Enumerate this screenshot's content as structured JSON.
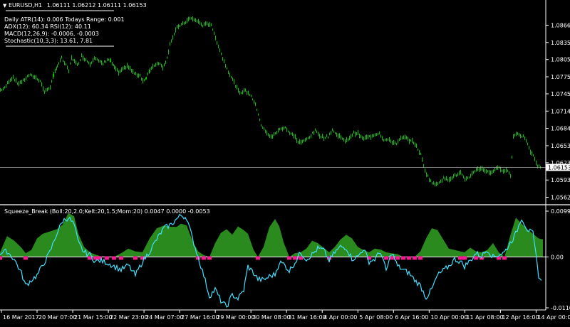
{
  "window": {
    "symbol_label": "EURUSD,H1",
    "ohlc": "1.06111 1.06212 1.06111 1.06153",
    "menu_icon": "triangle-down-icon"
  },
  "info_panel": {
    "atr": "Daily ATR(14): 0.006 Todays Range: 0.001",
    "adx_rsi": "ADX(12): 60.34 RSI(12): 40.11",
    "macd": "MACD(12,26,9): -0.0006, -0.0003",
    "stoch": "Stochastic(10,3,3): 13.61, 7.81"
  },
  "indicator": {
    "label": "Squeeze_Break (Boll:20,2.0;Kelt:20,1.5;Mom:20) 0.0047 0.0000 -0.0053"
  },
  "current_price": "1.06153",
  "colors": {
    "background": "#000000",
    "candle": "#00c800",
    "histogram": "#2a8a1e",
    "squeeze_dots": "#ff1493",
    "momentum_line": "#40e0ff",
    "price_line": "#b4b4b4",
    "axis_text": "#ffffff"
  },
  "chart_data": [
    {
      "type": "line",
      "name": "price",
      "yticks": [
        "1.08661",
        "1.08356",
        "1.08056",
        "1.07751",
        "1.07451",
        "1.07146",
        "1.06841",
        "1.06536",
        "1.06236",
        "1.05931",
        "1.05626"
      ],
      "xticks": [
        "16 Mar 2017",
        "20 Mar 07:00",
        "21 Mar 15:00",
        "22 Mar 23:00",
        "24 Mar 07:00",
        "27 Mar 16:00",
        "29 Mar 00:00",
        "30 Mar 08:00",
        "31 Mar 16:00",
        "4 Apr 00:00",
        "5 Apr 08:00",
        "6 Apr 16:00",
        "10 Apr 00:00",
        "11 Apr 08:00",
        "12 Apr 16:00",
        "14 Apr 00:00"
      ],
      "ylim": [
        1.0557,
        1.0898
      ],
      "current": 1.06153,
      "x": [
        0,
        6,
        12,
        18,
        24,
        32,
        40,
        48,
        56,
        62,
        70,
        75,
        80,
        86,
        92,
        96,
        100,
        104,
        108,
        114,
        120,
        126,
        132,
        138,
        144,
        150,
        155,
        160,
        166,
        172,
        178,
        184,
        190,
        196,
        200,
        205,
        210,
        216,
        222,
        228,
        234,
        238,
        244,
        248,
        252,
        256,
        260,
        266,
        272,
        278,
        284,
        290,
        296,
        300,
        306,
        312,
        318,
        324,
        330,
        336,
        342,
        346,
        352,
        358,
        362,
        366,
        370,
        376,
        382,
        388,
        394,
        400,
        406,
        412,
        418,
        424,
        430,
        436,
        442,
        448,
        454,
        460,
        466,
        472,
        478,
        484,
        490,
        496,
        502,
        508,
        514,
        520,
        526,
        532,
        538,
        544,
        550,
        556,
        562,
        568,
        574,
        580,
        586,
        590,
        594,
        598,
        602,
        606,
        610,
        616,
        622,
        628,
        634,
        640,
        646,
        652,
        658,
        664,
        670,
        676,
        682,
        688,
        694,
        700,
        706,
        712,
        716,
        720,
        726,
        730,
        736,
        742,
        748,
        754,
        760
      ],
      "values": [
        1.0752,
        1.0755,
        1.0768,
        1.0775,
        1.0763,
        1.0768,
        1.0778,
        1.0775,
        1.0768,
        1.0748,
        1.0758,
        1.0778,
        1.0795,
        1.0808,
        1.0795,
        1.0785,
        1.081,
        1.0802,
        1.0795,
        1.0812,
        1.0805,
        1.0798,
        1.081,
        1.0802,
        1.0798,
        1.0806,
        1.0803,
        1.0792,
        1.0782,
        1.0788,
        1.0795,
        1.0786,
        1.0779,
        1.0778,
        1.0768,
        1.0772,
        1.0788,
        1.0796,
        1.08,
        1.0792,
        1.0808,
        1.0834,
        1.085,
        1.0862,
        1.0866,
        1.0868,
        1.0872,
        1.0878,
        1.0876,
        1.0872,
        1.0866,
        1.0868,
        1.0868,
        1.085,
        1.083,
        1.0808,
        1.079,
        1.0775,
        1.076,
        1.0745,
        1.0752,
        1.0748,
        1.0742,
        1.0725,
        1.071,
        1.069,
        1.0682,
        1.0672,
        1.067,
        1.0678,
        1.0684,
        1.0686,
        1.0675,
        1.0672,
        1.066,
        1.066,
        1.0665,
        1.0672,
        1.068,
        1.0672,
        1.0668,
        1.067,
        1.0682,
        1.0672,
        1.067,
        1.066,
        1.0668,
        1.0676,
        1.0675,
        1.0666,
        1.0668,
        1.067,
        1.0674,
        1.0676,
        1.0664,
        1.0664,
        1.066,
        1.0658,
        1.0666,
        1.0668,
        1.0663,
        1.066,
        1.0648,
        1.0638,
        1.0618,
        1.0604,
        1.0595,
        1.0588,
        1.0585,
        1.059,
        1.0596,
        1.0594,
        1.0598,
        1.0602,
        1.0606,
        1.0592,
        1.0598,
        1.0608,
        1.0612,
        1.0614,
        1.0608,
        1.0606,
        1.0612,
        1.0614,
        1.061,
        1.061,
        1.06,
        1.067,
        1.0676,
        1.0672,
        1.0668,
        1.0648,
        1.0635,
        1.0618,
        1.0615
      ]
    },
    {
      "type": "area",
      "name": "Squeeze_Break",
      "ylim": [
        -0.011,
        0.0099
      ],
      "yticks": [
        "0.0099",
        "0.00",
        "-0.0110"
      ],
      "x": [
        0,
        10,
        20,
        30,
        36,
        44,
        52,
        60,
        70,
        80,
        88,
        96,
        104,
        110,
        118,
        126,
        134,
        140,
        150,
        160,
        170,
        180,
        190,
        200,
        210,
        220,
        230,
        240,
        248,
        254,
        262,
        270,
        278,
        286,
        294,
        302,
        310,
        318,
        326,
        334,
        342,
        348,
        356,
        362,
        370,
        378,
        386,
        392,
        398,
        406,
        414,
        422,
        430,
        438,
        446,
        454,
        462,
        470,
        478,
        486,
        494,
        502,
        510,
        518,
        526,
        534,
        542,
        550,
        558,
        566,
        574,
        582,
        590,
        598,
        606,
        614,
        622,
        630,
        638,
        646,
        652,
        660,
        668,
        676,
        684,
        692,
        700,
        708,
        716,
        724,
        732,
        740,
        748,
        756,
        762
      ],
      "histogram": [
        0.001,
        0.0045,
        0.0035,
        0.002,
        0.0008,
        0.0015,
        0.004,
        0.005,
        0.0055,
        0.006,
        0.007,
        0.0095,
        0.0088,
        0.005,
        0.0022,
        0.001,
        0.0005,
        0.0002,
        0.0,
        0.0,
        0.0008,
        0.0018,
        0.0012,
        0.001,
        0.004,
        0.0062,
        0.0068,
        0.0065,
        0.0065,
        0.0072,
        0.0068,
        0.0035,
        0.0012,
        0.0004,
        0.0,
        0.003,
        0.0052,
        0.006,
        0.0048,
        0.0066,
        0.0058,
        0.005,
        0.0015,
        0.0,
        0.0022,
        0.0064,
        0.0082,
        0.0066,
        0.0032,
        0.0,
        0.0008,
        0.001,
        0.0018,
        0.0035,
        0.003,
        0.002,
        0.001,
        0.0022,
        0.0038,
        0.0048,
        0.004,
        0.0022,
        0.0015,
        0.001,
        0.0018,
        0.0016,
        0.001,
        0.0008,
        0.0006,
        0.0,
        0.0,
        0.0,
        0.0012,
        0.004,
        0.0062,
        0.0058,
        0.0038,
        0.0018,
        0.0015,
        0.0012,
        0.001,
        0.002,
        0.0012,
        0.001,
        0.0015,
        0.003,
        0.001,
        0.0,
        0.0045,
        0.0085,
        0.0072,
        0.006,
        0.005,
        0.004,
        0.0038
      ],
      "momentum": [
        0.0008,
        0.0012,
        -0.0005,
        -0.0035,
        -0.0062,
        -0.005,
        -0.004,
        -0.0018,
        0.001,
        0.0052,
        0.0078,
        0.0085,
        0.007,
        0.003,
        0.001,
        0.0005,
        -0.001,
        -0.0008,
        -0.0012,
        -0.002,
        -0.0028,
        -0.0018,
        -0.004,
        -0.001,
        0.0012,
        0.0038,
        0.0062,
        0.007,
        0.0082,
        0.009,
        0.0085,
        0.004,
        0.0,
        -0.004,
        -0.0085,
        -0.007,
        -0.0095,
        -0.0108,
        -0.0082,
        -0.009,
        -0.0072,
        -0.002,
        -0.0035,
        -0.0048,
        -0.005,
        -0.0042,
        -0.0038,
        -0.0012,
        -0.0015,
        -0.003,
        -0.0012,
        0.001,
        -0.0005,
        0.0005,
        0.0018,
        0.0015,
        -0.0008,
        0.001,
        0.0022,
        0.002,
        -0.0004,
        0.0,
        0.0018,
        -0.001,
        -0.0005,
        0.0012,
        -0.003,
        0.001,
        -0.002,
        -0.0028,
        -0.0035,
        -0.005,
        -0.0062,
        -0.0088,
        -0.007,
        -0.004,
        -0.003,
        -0.002,
        -0.0005,
        -0.001,
        -0.002,
        -0.0008,
        0.0008,
        0.0002,
        0.0016,
        0.0,
        0.0005,
        0.001,
        0.003,
        0.005,
        0.0085,
        0.006,
        0.005,
        -0.004,
        -0.0062
      ]
    }
  ]
}
